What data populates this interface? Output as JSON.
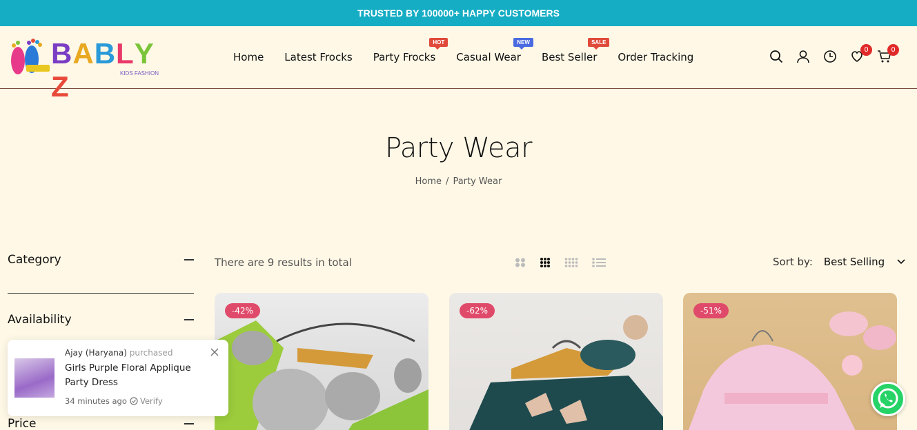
{
  "topbar": {
    "text": "TRUSTED BY 100000+ HAPPY CUSTOMERS"
  },
  "logo": {
    "letters": [
      "B",
      "A",
      "B",
      "L",
      "Y",
      "Z"
    ],
    "subtitle": "KIDS FASHION",
    "colors": [
      "#7a3dc4",
      "#e8a820",
      "#2a9ad8",
      "#e83a6a",
      "#7ac43a",
      "#e84a3a"
    ]
  },
  "nav": {
    "items": [
      {
        "label": "Home",
        "badge": ""
      },
      {
        "label": "Latest Frocks",
        "badge": ""
      },
      {
        "label": "Party Frocks",
        "badge": "HOT"
      },
      {
        "label": "Casual Wear",
        "badge": "NEW"
      },
      {
        "label": "Best Seller",
        "badge": "SALE"
      },
      {
        "label": "Order Tracking",
        "badge": ""
      }
    ]
  },
  "header_icons": {
    "wishlist_count": "0",
    "cart_count": "0"
  },
  "page": {
    "title": "Party Wear",
    "breadcrumb_home": "Home",
    "breadcrumb_sep": "/",
    "breadcrumb_current": "Party Wear"
  },
  "sidebar": {
    "category": "Category",
    "availability": "Availability",
    "price": "Price"
  },
  "toolbar": {
    "results": "There are 9 results in total",
    "sort_label": "Sort by:",
    "sort_value": "Best Selling"
  },
  "products": [
    {
      "discount": "-42%"
    },
    {
      "discount": "-62%"
    },
    {
      "discount": "-51%"
    }
  ],
  "popup": {
    "who": "Ajay (Haryana)",
    "action": "purchased",
    "product": "Girls Purple Floral Applique Party Dress",
    "time": "34 minutes ago",
    "verify": "Verify"
  },
  "colors": {
    "accent": "#15adc4",
    "background": "#fff8e6",
    "badge_red": "#e04a3a",
    "badge_blue": "#4a6ae0",
    "discount": "#e04a6a"
  }
}
